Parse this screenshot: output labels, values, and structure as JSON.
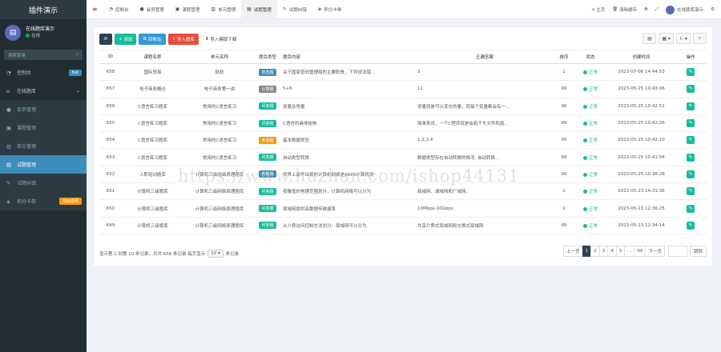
{
  "app": {
    "title": "插件演示"
  },
  "user": {
    "name": "在线题库演示",
    "status": "在线"
  },
  "sidebar": {
    "search_placeholder": "搜索菜单",
    "items": [
      {
        "label": "控制台",
        "icon": "dashboard-icon",
        "badge": "hot",
        "badge_color": "#3c8dbc",
        "type": "main"
      },
      {
        "label": "在线题库",
        "icon": "bank-icon",
        "type": "main",
        "expandable": true
      },
      {
        "label": "会员管理",
        "icon": "user-icon",
        "type": "sub"
      },
      {
        "label": "课程管理",
        "icon": "book-icon",
        "type": "sub"
      },
      {
        "label": "单元管理",
        "icon": "chart-icon",
        "type": "sub"
      },
      {
        "label": "试题管理",
        "icon": "file-icon",
        "type": "sub",
        "active": true
      },
      {
        "label": "试题纠错",
        "icon": "edit-icon",
        "type": "sub"
      },
      {
        "label": "积分卡券",
        "icon": "ticket-icon",
        "type": "sub",
        "badge": "高级插件",
        "badge_color": "#f39c12"
      }
    ]
  },
  "topbar": {
    "tabs": [
      {
        "label": "控制台",
        "icon": "dashboard-icon"
      },
      {
        "label": "会员管理",
        "icon": "user-icon"
      },
      {
        "label": "课程管理",
        "icon": "book-icon"
      },
      {
        "label": "单元管理",
        "icon": "chart-icon"
      },
      {
        "label": "试题管理",
        "icon": "file-icon",
        "active": true
      },
      {
        "label": "试题纠错",
        "icon": "edit-icon"
      },
      {
        "label": "积分卡券",
        "icon": "ticket-icon"
      }
    ],
    "right": {
      "home": "主页",
      "clear_cache": "清除缓存",
      "user": "在线题库演示"
    }
  },
  "toolbar": {
    "add": "添加",
    "recycle": "回收站",
    "import": "导入题库",
    "download": "导入模版下载"
  },
  "table": {
    "headers": [
      "ID",
      "课程名称",
      "单元名称",
      "题目类型",
      "题目内容",
      "正确答案",
      "排序",
      "状态",
      "创建时间",
      "操作"
    ],
    "rows": [
      {
        "id": "658",
        "course": "国际贸易",
        "unit": "财政",
        "type": "单选题",
        "type_color": "#3c8dbc",
        "content": "关于国家密码管理局的主要职责，下列说法错...",
        "answer": "3",
        "sort": "1",
        "status": "正常",
        "time": "2023-07-06 14:44:53"
      },
      {
        "id": "657",
        "course": "电子商务概论",
        "unit": "电子商务第一讲",
        "type": "计算题",
        "type_color": "#7f8c8d",
        "content": "5+6",
        "answer": "11",
        "sort": "99",
        "status": "正常",
        "time": "2023-05-25 10:43:06"
      },
      {
        "id": "656",
        "course": "C语言练习题库",
        "unit": "常用的C语言练习",
        "type": "问答题",
        "type_color": "#18bc9c",
        "content": "变量及常量",
        "answer": "变量就是可以变化的量，而每个变量都会有一...",
        "sort": "99",
        "status": "正常",
        "time": "2023-05-25 10:42:51"
      },
      {
        "id": "655",
        "course": "C语言练习题库",
        "unit": "常用的C语言练习",
        "type": "问答题",
        "type_color": "#18bc9c",
        "content": "C语言的具体结构",
        "answer": "简单来说，一个C程序就是由若干头文件和函...",
        "sort": "99",
        "status": "正常",
        "time": "2023-05-25 10:42:26"
      },
      {
        "id": "654",
        "course": "C语言练习题库",
        "unit": "常用的C语言练习",
        "type": "多选题",
        "type_color": "#f39c12",
        "content": "基本数据类型",
        "answer": "1,2,3,4",
        "sort": "99",
        "status": "正常",
        "time": "2023-05-25 10:42:10"
      },
      {
        "id": "653",
        "course": "C语言练习题库",
        "unit": "常用的C语言练习",
        "type": "问答题",
        "type_color": "#18bc9c",
        "content": "自动类型转换",
        "answer": "数据类型存在自动转换的情况. 自动转换...",
        "sort": "99",
        "status": "正常",
        "time": "2023-05-25 10:41:54"
      },
      {
        "id": "652",
        "course": "入职培训题库",
        "unit": "计算机三级网络原理题库",
        "type": "判断题",
        "type_color": "#3c8dbc",
        "content": "世界上最早出现的计算机网络是ARPA计算机网",
        "answer": "",
        "sort": "99",
        "status": "正常",
        "time": "2023-05-25 10:36:28"
      },
      {
        "id": "651",
        "course": "计算机三级题库",
        "unit": "计算机三级网络原理题库",
        "type": "问答题",
        "type_color": "#18bc9c",
        "content": "按覆盖的地理范围划分，计算机网络可以分为",
        "answer": "局域网、城域网和广域网。",
        "sort": "1",
        "status": "正常",
        "time": "2023-05-23 14:31:36"
      },
      {
        "id": "650",
        "course": "计算机三级题库",
        "unit": "计算机三级网络原理题库",
        "type": "问答题",
        "type_color": "#18bc9c",
        "content": "局域网提供高数据传输速率",
        "answer": "10Mbps-10Gbps",
        "sort": "2",
        "status": "正常",
        "time": "2023-05-23 12:36:25"
      },
      {
        "id": "649",
        "course": "计算机三级题库",
        "unit": "计算机三级网络原理题库",
        "type": "问答题",
        "type_color": "#18bc9c",
        "content": "从介质访问控制方法划分，局域网可以分为",
        "answer": "共享介质式局域网和交换式局域网",
        "sort": "99",
        "status": "正常",
        "time": "2023-05-23 12:34:14"
      }
    ]
  },
  "footer": {
    "info_left": "显示第 1 到第 10 条记录，总共 658 条记录 每页显示",
    "page_size": "10",
    "info_right": "条记录"
  },
  "pagination": {
    "prev": "上一页",
    "pages": [
      "1",
      "2",
      "3",
      "4",
      "5",
      "...",
      "66"
    ],
    "next": "下一页",
    "jump": "跳转"
  },
  "watermark": "https://www.huzhan.com/ishop44131"
}
